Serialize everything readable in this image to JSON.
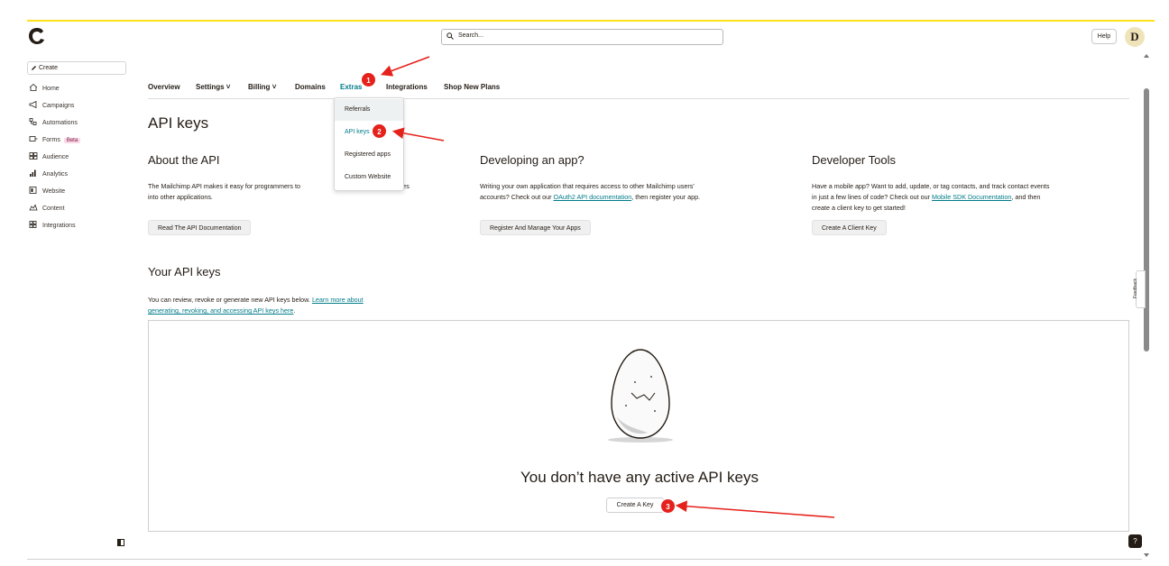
{
  "topbar": {
    "search_placeholder": "Search...",
    "help_label": "Help",
    "avatar_initial": "D",
    "logo_icon": "freddie-logo-icon",
    "accent_color": "#ffe01b"
  },
  "sidebar": {
    "create_label": "Create",
    "items": [
      {
        "label": "Home",
        "icon": "home-icon"
      },
      {
        "label": "Campaigns",
        "icon": "megaphone-icon"
      },
      {
        "label": "Automations",
        "icon": "automation-icon"
      },
      {
        "label": "Forms",
        "icon": "forms-icon",
        "badge": "Beta"
      },
      {
        "label": "Audience",
        "icon": "audience-icon"
      },
      {
        "label": "Analytics",
        "icon": "chart-icon"
      },
      {
        "label": "Website",
        "icon": "website-icon"
      },
      {
        "label": "Content",
        "icon": "content-icon"
      },
      {
        "label": "Integrations",
        "icon": "grid-icon"
      }
    ]
  },
  "tabs": [
    {
      "label": "Overview"
    },
    {
      "label": "Settings"
    },
    {
      "label": "Billing"
    },
    {
      "label": "Domains"
    },
    {
      "label": "Extras"
    },
    {
      "label": "Integrations"
    },
    {
      "label": "Shop New Plans"
    }
  ],
  "extras_menu": [
    "Referrals",
    "API keys",
    "Registered apps",
    "Custom Website"
  ],
  "page_title": "API keys",
  "columns": [
    {
      "heading": "About the API",
      "text_before": "The Mailchimp API makes it easy for programmers to",
      "text_hidden_gap": "",
      "text_after": "p's features",
      "text_line2": "into other applications.",
      "button": "Read The API Documentation"
    },
    {
      "heading": "Developing an app?",
      "text_line1": "Writing your own application that requires access to other Mailchimp users'",
      "text_line2_before": "accounts? Check out our ",
      "text_link": "OAuth2 API documentation",
      "text_line2_after": ", then register your app.",
      "button": "Register And Manage Your Apps"
    },
    {
      "heading": "Developer Tools",
      "text_line1": "Have a mobile app? Want to add, update, or tag contacts, and track contact events",
      "text_line2_before": "in just a few lines of code? Check out our ",
      "text_link": "Mobile SDK Documentation",
      "text_line2_after": ", and then",
      "text_line3": "create a client key to get started!",
      "button": "Create A Client Key"
    }
  ],
  "your_keys": {
    "heading": "Your API keys",
    "text_before": "You can review, revoke or generate new API keys below. ",
    "link_line1": "Learn more about",
    "link_line2": "generating, revoking, and accessing API keys here",
    "text_after": "."
  },
  "empty_state": {
    "heading": "You don’t have any active API keys",
    "button": "Create A Key",
    "illustration": "cracked-egg-illustration"
  },
  "feedback_label": "Feedback",
  "help_fab": "?",
  "annotations": [
    "1",
    "2",
    "3"
  ],
  "annotation_color": "#e5211b"
}
